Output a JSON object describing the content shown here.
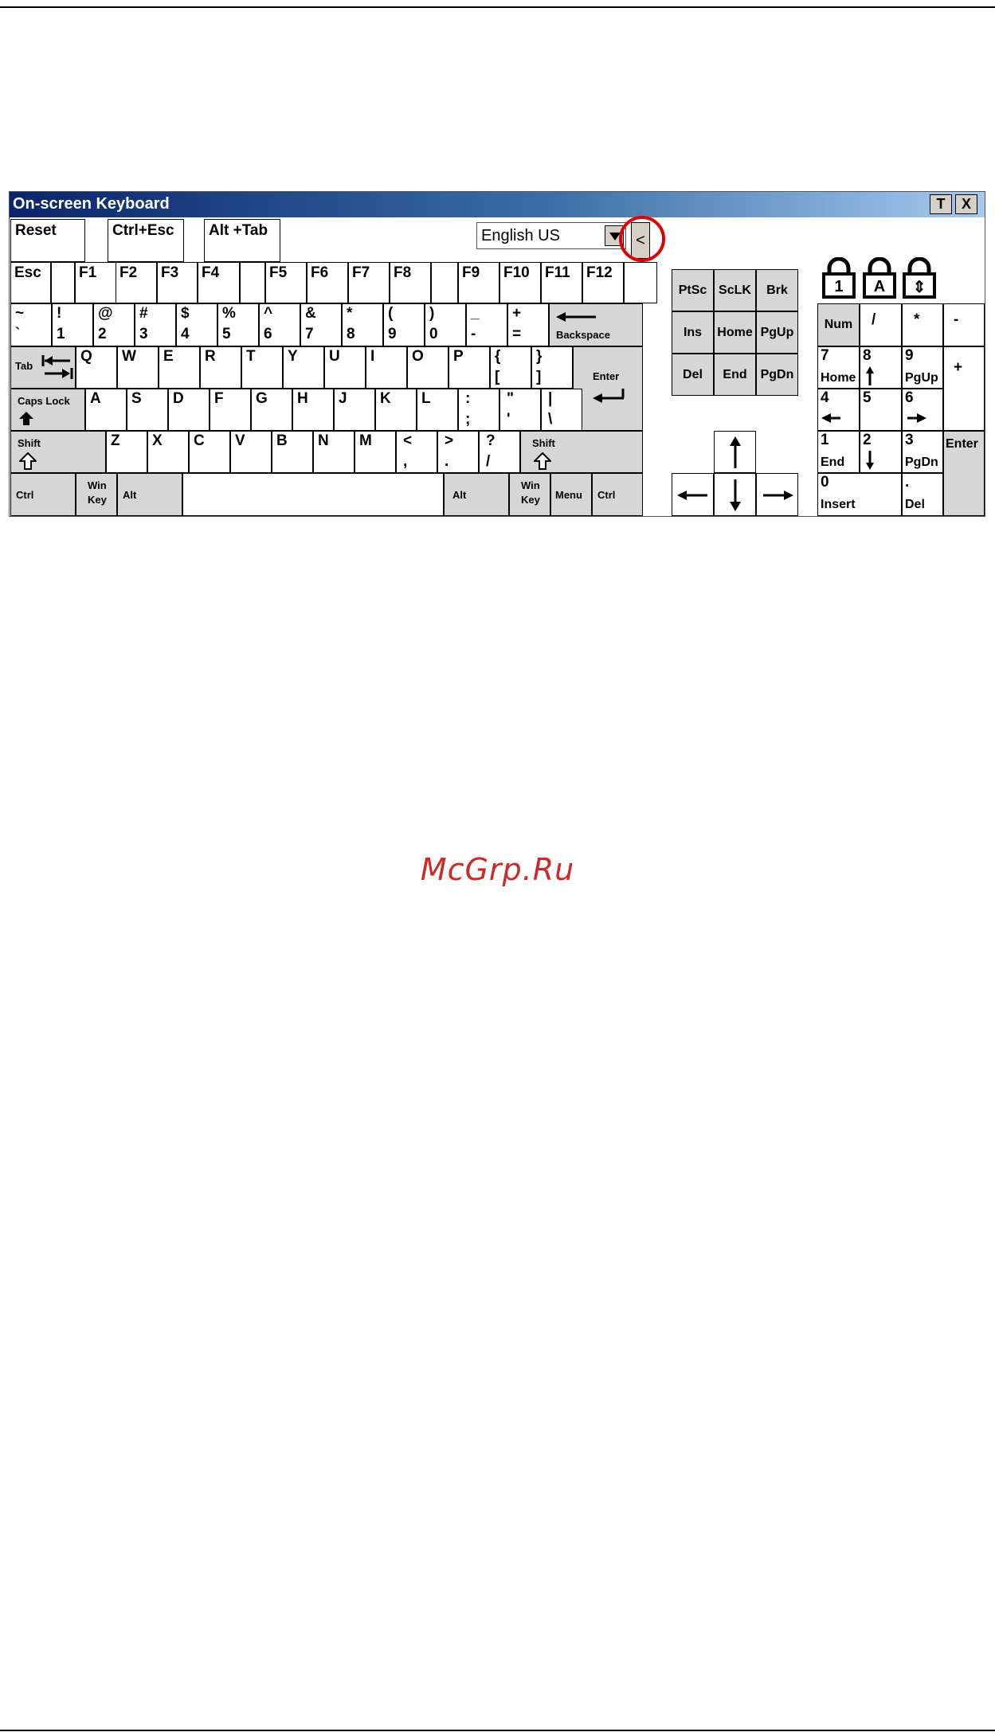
{
  "window": {
    "title": "On-screen Keyboard",
    "titlebar_buttons": [
      "T",
      "X"
    ],
    "accent": "#0a246a",
    "highlight_color": "#e00000"
  },
  "toolbar": {
    "reset": "Reset",
    "ctrl_esc": "Ctrl+Esc",
    "alt_tab": "Alt +Tab",
    "language": "English US",
    "collapse": "<"
  },
  "function_row": [
    "Esc",
    "F1",
    "F2",
    "F3",
    "F4",
    "F5",
    "F6",
    "F7",
    "F8",
    "F9",
    "F10",
    "F11",
    "F12"
  ],
  "number_row": {
    "top": [
      "~",
      "!",
      "@",
      "#",
      "$",
      "%",
      "^",
      "&",
      "*",
      "(",
      ")",
      "_",
      "+"
    ],
    "bottom": [
      "`",
      "1",
      "2",
      "3",
      "4",
      "5",
      "6",
      "7",
      "8",
      "9",
      "0",
      "-",
      "="
    ],
    "backspace": "Backspace"
  },
  "qwerty_row": {
    "tab": "Tab",
    "keys": [
      "Q",
      "W",
      "E",
      "R",
      "T",
      "Y",
      "U",
      "I",
      "O",
      "P"
    ],
    "brackets_top": [
      "{",
      "}"
    ],
    "brackets_bottom": [
      "[",
      "]"
    ],
    "enter": "Enter"
  },
  "home_row": {
    "caps": "Caps Lock",
    "keys": [
      "A",
      "S",
      "D",
      "F",
      "G",
      "H",
      "J",
      "K",
      "L"
    ],
    "punct_top": [
      ":",
      "\"",
      "|"
    ],
    "punct_bottom": [
      ";",
      "'",
      "\\"
    ]
  },
  "shift_row": {
    "shift": "Shift",
    "keys": [
      "Z",
      "X",
      "C",
      "V",
      "B",
      "N",
      "M"
    ],
    "punct_top": [
      "<",
      ">",
      "?"
    ],
    "punct_bottom": [
      ",",
      ".",
      "/"
    ]
  },
  "bottom_row": {
    "ctrl": "Ctrl",
    "win_top": "Win",
    "win_bottom": "Key",
    "alt": "Alt",
    "menu": "Menu"
  },
  "nav_cluster": {
    "row1": [
      "PtSc",
      "ScLK",
      "Brk"
    ],
    "row2": [
      "Ins",
      "Home",
      "PgUp"
    ],
    "row3": [
      "Del",
      "End",
      "PgDn"
    ]
  },
  "numpad": {
    "num": "Num",
    "slash": "/",
    "star": "*",
    "minus": "-",
    "plus": "+",
    "enter": "Enter",
    "k7": [
      "7",
      "Home"
    ],
    "k8": "8",
    "k9": [
      "9",
      "PgUp"
    ],
    "k4": "4",
    "k5": "5",
    "k6": "6",
    "k1": [
      "1",
      "End"
    ],
    "k2": "2",
    "k3": [
      "3",
      "PgDn"
    ],
    "k0": [
      "0",
      "Insert"
    ],
    "kdot": [
      ".",
      "Del"
    ]
  },
  "lock_indicators": [
    "1",
    "A",
    "⇕"
  ],
  "watermark": "McGrp.Ru"
}
